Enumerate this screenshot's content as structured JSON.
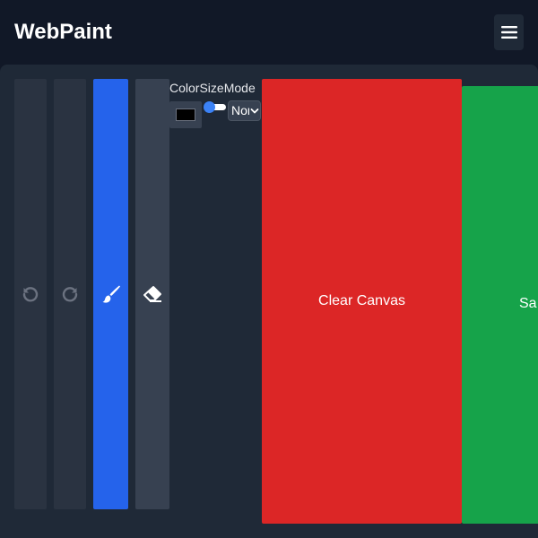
{
  "header": {
    "title": "WebPaint",
    "menu_icon": "hamburger-menu-icon"
  },
  "toolbar": {
    "tools": [
      {
        "name": "undo",
        "icon": "undo-icon",
        "active": false
      },
      {
        "name": "redo",
        "icon": "redo-icon",
        "active": false
      },
      {
        "name": "brush",
        "icon": "paintbrush-icon",
        "active": true
      },
      {
        "name": "eraser",
        "icon": "eraser-icon",
        "active": false
      }
    ],
    "color_label": "Color",
    "size_label": "Size",
    "mode_label": "Mode",
    "color_value": "#000000",
    "size_value": 0.1,
    "mode_value": "Normal",
    "clear_label": "Clear Canvas",
    "save_label": "Sa"
  },
  "colors": {
    "background": "#111827",
    "panel": "#1f2937",
    "accent": "#2563eb",
    "danger": "#dc2626",
    "success": "#16a34a"
  }
}
